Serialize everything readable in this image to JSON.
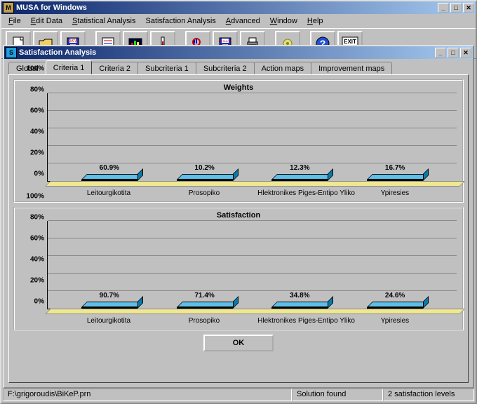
{
  "window": {
    "title": "MUSA for Windows"
  },
  "menu": {
    "file": "File",
    "edit": "Edit Data",
    "stat": "Statistical Analysis",
    "sat": "Satisfaction Analysis",
    "adv": "Advanced",
    "win": "Window",
    "help": "Help"
  },
  "child": {
    "title": "Satisfaction Analysis"
  },
  "tabs": {
    "global": "Global",
    "crit1": "Criteria 1",
    "crit2": "Criteria 2",
    "sub1": "Subcriteria 1",
    "sub2": "Subcriteria 2",
    "action": "Action maps",
    "impr": "Improvement maps"
  },
  "yticks": {
    "t0": "0%",
    "t20": "20%",
    "t40": "40%",
    "t60": "60%",
    "t80": "80%",
    "t100": "100%"
  },
  "chart_data": [
    {
      "type": "bar",
      "title": "Weights",
      "categories": [
        "Leitourgikotita",
        "Prosopiko",
        "Hlektronikes Piges-Entipo Yliko",
        "Ypiresies"
      ],
      "values": [
        60.9,
        10.2,
        12.3,
        16.7
      ],
      "labels": [
        "60.9%",
        "10.2%",
        "12.3%",
        "16.7%"
      ],
      "ylabel": "%",
      "ylim": [
        0,
        100
      ]
    },
    {
      "type": "bar",
      "title": "Satisfaction",
      "categories": [
        "Leitourgikotita",
        "Prosopiko",
        "Hlektronikes Piges-Entipo Yliko",
        "Ypiresies"
      ],
      "values": [
        90.7,
        71.4,
        34.8,
        24.6
      ],
      "labels": [
        "90.7%",
        "71.4%",
        "34.8%",
        "24.6%"
      ],
      "ylabel": "%",
      "ylim": [
        0,
        100
      ]
    }
  ],
  "buttons": {
    "ok": "OK"
  },
  "status": {
    "path": "F:\\grigoroudis\\BiKeP.prn",
    "sol": "Solution found",
    "levels": "2 satisfaction levels"
  },
  "toolbar_icons": {
    "new": "new-icon",
    "open": "open-icon",
    "save": "save-icon",
    "edit": "edit-icon",
    "stats": "stats-icon",
    "thermo": "thermo-icon",
    "zoom": "zoom-icon",
    "results": "results-icon",
    "print": "print-icon",
    "config": "config-icon",
    "help": "help-icon",
    "exit": "exit-icon"
  }
}
